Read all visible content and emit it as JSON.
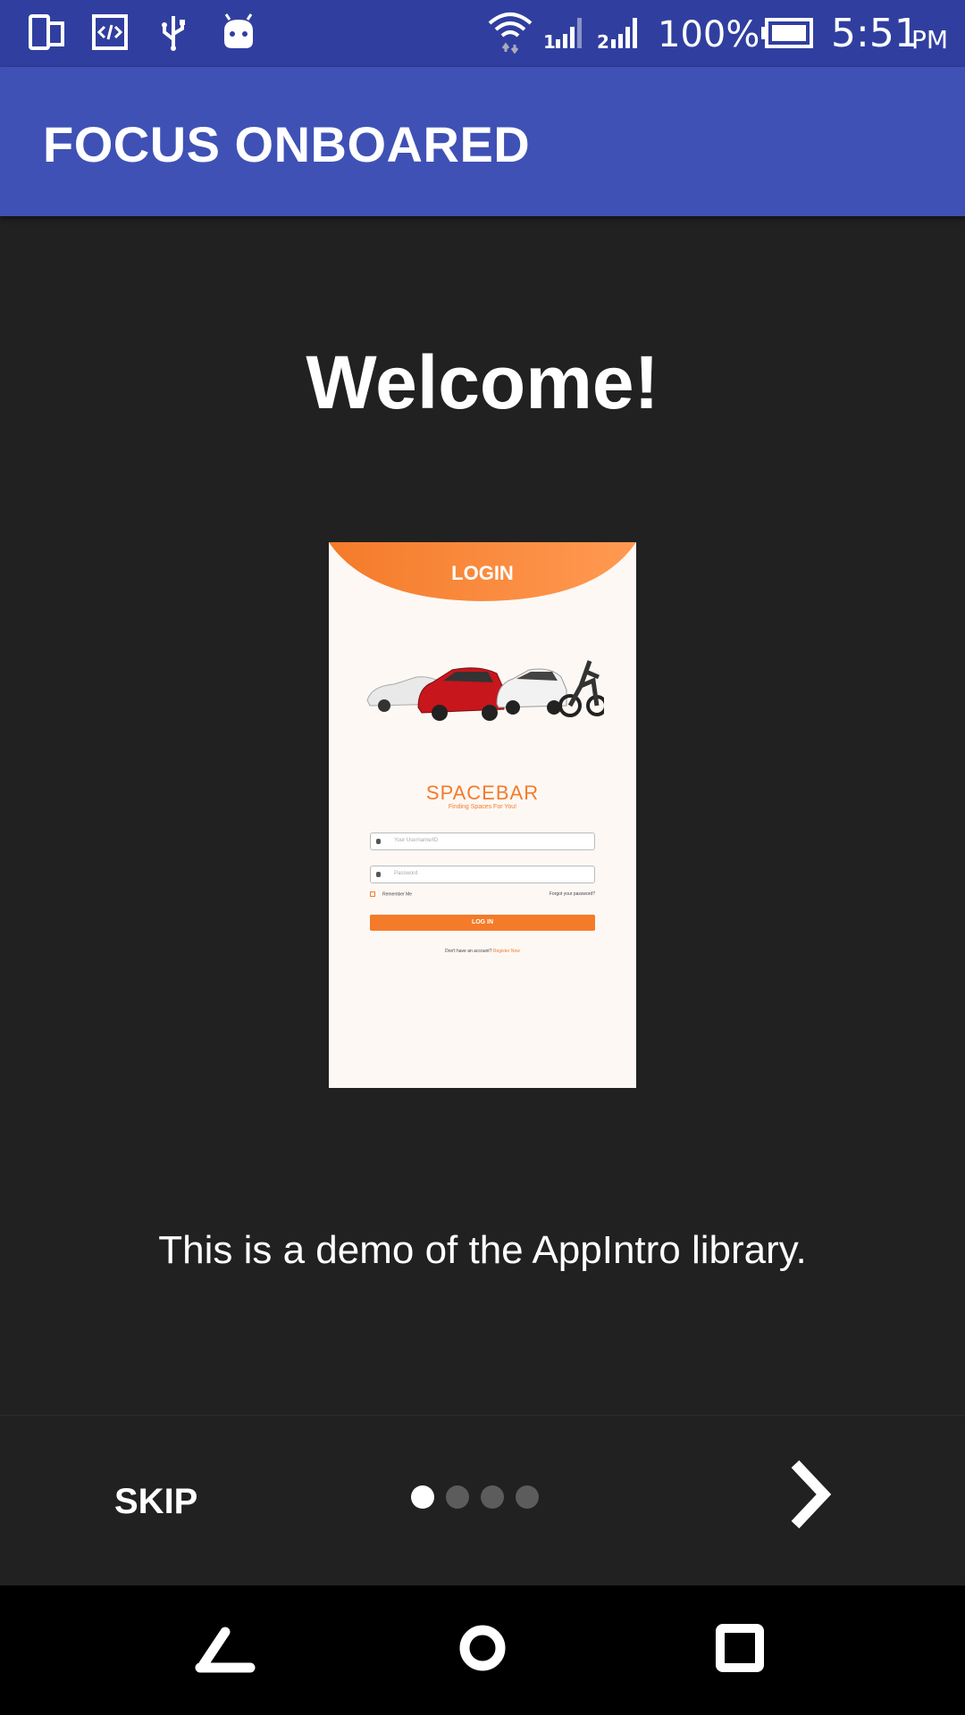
{
  "status_bar": {
    "battery": "100%",
    "time": "5:51",
    "ampm": "PM",
    "icons": [
      "phone-device-icon",
      "code-icon",
      "usb-icon",
      "android-icon",
      "wifi-icon",
      "signal-1-icon",
      "signal-2-icon",
      "battery-icon"
    ]
  },
  "app_bar": {
    "title": "FOCUS ONBOARED"
  },
  "slide": {
    "title": "Welcome!",
    "description": "This is a demo of the AppIntro library.",
    "preview": {
      "header": "LOGIN",
      "brand": "SPACEBAR",
      "tagline": "Finding Spaces For You!",
      "username_placeholder": "Your Username/ID",
      "password_placeholder": "Password",
      "remember": "Remember Me",
      "forgot": "Forgot your password?",
      "login_button": "LOG IN",
      "register_prefix": "Don't have an account? ",
      "register_link": "Register Now",
      "accent_color": "#f47b2a"
    }
  },
  "intro_nav": {
    "skip_label": "SKIP",
    "page_count": 4,
    "current_page": 1
  },
  "colors": {
    "status_bar": "#303f9f",
    "app_bar": "#3f51b5",
    "background": "#212121"
  }
}
